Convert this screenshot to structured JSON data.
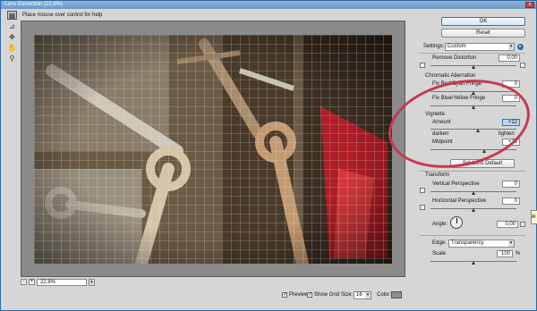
{
  "window": {
    "title": "Lens Correction (22,8%)",
    "close_glyph": "x"
  },
  "hint": "Place mouse over control for help",
  "tools": [
    "remove-distortion-tool-icon",
    "straighten-tool-icon",
    "move-grid-tool-icon",
    "hand-tool-icon",
    "zoom-tool-icon"
  ],
  "zoom": {
    "minus": "-",
    "plus": "+",
    "value": "22,8%",
    "arrow": "▾"
  },
  "bottom": {
    "preview_label": "Preview",
    "show_grid_label": "Show Grid",
    "size_label": "Size:",
    "size_value": "16",
    "color_label": "Color:",
    "check": "✓",
    "arrow": "▾",
    "grid_color": "#8e8e8e"
  },
  "panel": {
    "ok": "OK",
    "reset": "Reset",
    "settings_label": "Settings:",
    "settings_value": "Custom",
    "remove_distortion": {
      "label": "Remove Distortion",
      "value": "0,00"
    },
    "chromatic_header": "Chromatic Aberration",
    "fix_red_cyan": {
      "label": "Fix Red/Cyan Fringe",
      "value": "0"
    },
    "fix_blue_yellow": {
      "label": "Fix Blue/Yellow Fringe",
      "value": "0"
    },
    "vignette_header": "Vignette",
    "amount": {
      "label": "Amount",
      "value": "+12",
      "left": "darken",
      "right": "lighten"
    },
    "midpoint": {
      "label": "Midpoint",
      "value": "+25"
    },
    "set_lens_default": "Set Lens Default",
    "transform_header": "Transform",
    "vertical_perspective": {
      "label": "Vertical Perspective",
      "value": "0"
    },
    "horizontal_perspective": {
      "label": "Horizontal Perspective",
      "value": "0"
    },
    "angle": {
      "label": "Angle:",
      "value": "0,00"
    },
    "edge": {
      "label": "Edge:",
      "value": "Transparency"
    },
    "scale": {
      "label": "Scale",
      "value": "100",
      "unit": "%"
    }
  },
  "tooltip_tab": "Al",
  "colors": {
    "annotation": "#c9384d",
    "title_bar": "#7aa3cd",
    "focus": "#bfd4f2"
  }
}
